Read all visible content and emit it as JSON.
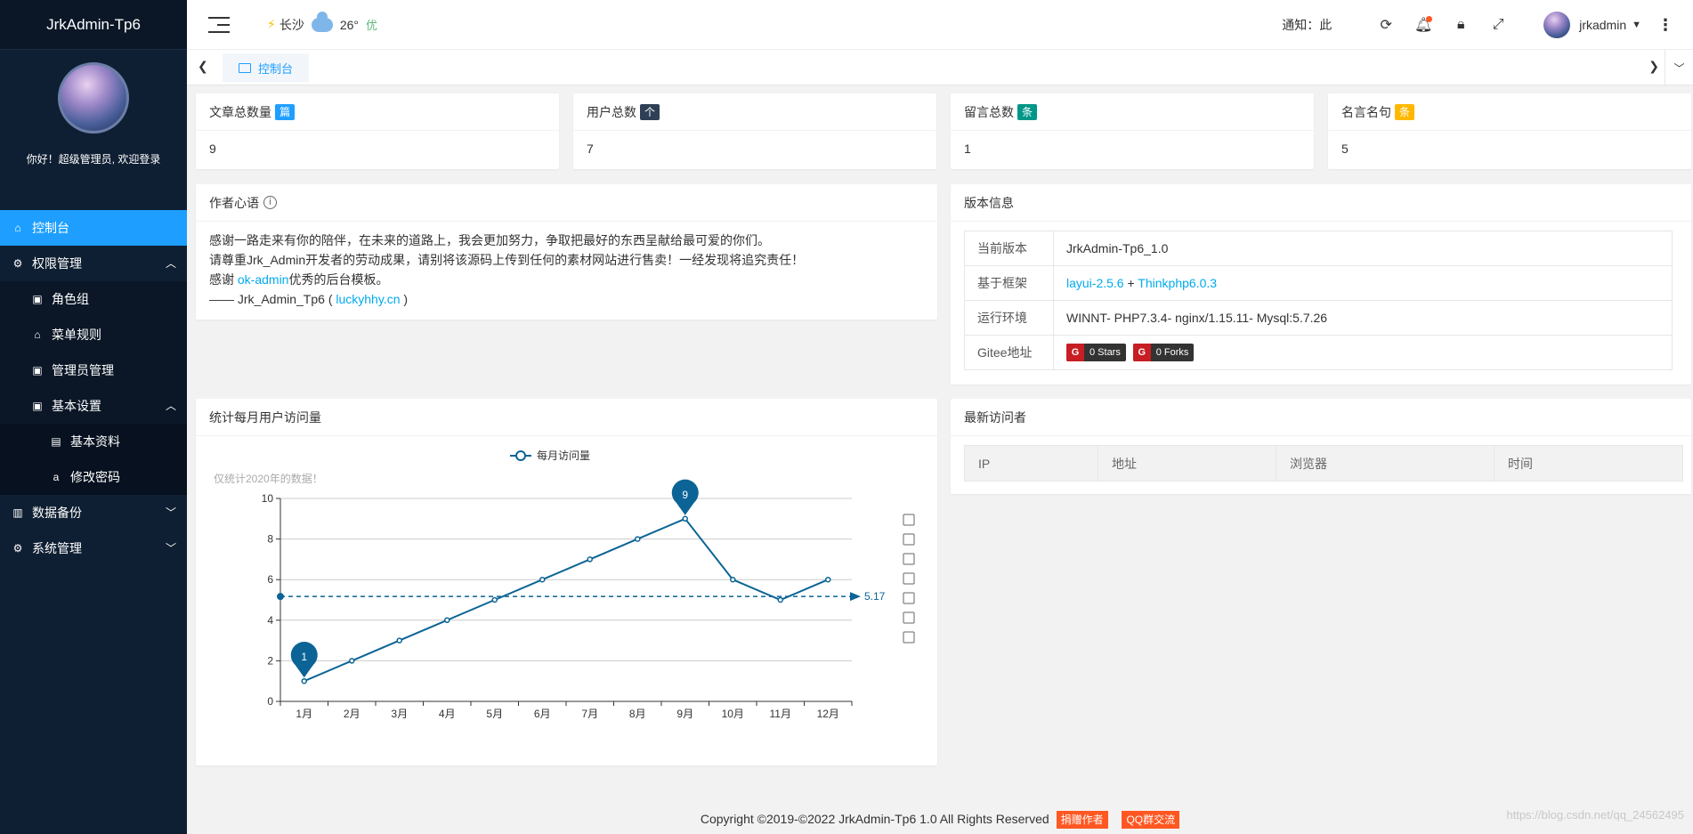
{
  "brand": "JrkAdmin-Tp6",
  "welcome": "你好！超级管理员, 欢迎登录",
  "menu": {
    "dashboard": "控制台",
    "auth": "权限管理",
    "role_group": "角色组",
    "menu_rules": "菜单规则",
    "admin_manage": "管理员管理",
    "basic_settings": "基本设置",
    "basic_profile": "基本资料",
    "change_password": "修改密码",
    "data_backup": "数据备份",
    "system_manage": "系统管理"
  },
  "header": {
    "city": "长沙",
    "temp": "26°",
    "air": "优",
    "notice": "通知：此",
    "username": "jrkadmin"
  },
  "tab": {
    "active": "控制台"
  },
  "stats": [
    {
      "label": "文章总数量",
      "badge": "篇",
      "value": "9",
      "color": "#1E9FFF"
    },
    {
      "label": "用户总数",
      "badge": "个",
      "value": "7",
      "color": "#2F4056"
    },
    {
      "label": "留言总数",
      "badge": "条",
      "value": "1",
      "color": "#009688"
    },
    {
      "label": "名言名句",
      "badge": "条",
      "value": "5",
      "color": "#FFB800"
    }
  ],
  "author": {
    "title": "作者心语",
    "line1": "感谢一路走来有你的陪伴，在未来的道路上，我会更加努力，争取把最好的东西呈献给最可爱的你们。",
    "line2": "请尊重Jrk_Admin开发者的劳动成果，请别将该源码上传到任何的素材网站进行售卖！一经发现将追究责任！",
    "line3_pre": "感谢 ",
    "line3_link": "ok-admin",
    "line3_post": "优秀的后台模板。",
    "line4_pre": "—— Jrk_Admin_Tp6 ( ",
    "line4_link": "luckyhhy.cn",
    "line4_post": " )"
  },
  "version": {
    "title": "版本信息",
    "rows": {
      "current_k": "当前版本",
      "current_v": "JrkAdmin-Tp6_1.0",
      "framework_k": "基于框架",
      "framework_v1": "layui-2.5.6",
      "framework_plus": " + ",
      "framework_v2": "Thinkphp6.0.3",
      "env_k": "运行环境",
      "env_v": "WINNT- PHP7.3.4- nginx/1.15.11- Mysql:5.7.26",
      "gitee_k": "Gitee地址",
      "gitee_g": "G",
      "stars": "0 Stars",
      "forks": "0 Forks"
    }
  },
  "chart_card": {
    "title": "统计每月用户访问量"
  },
  "visitors": {
    "title": "最新访问者",
    "columns": [
      "IP",
      "地址",
      "浏览器",
      "时间"
    ]
  },
  "chart_data": {
    "type": "line",
    "subtitle": "仅统计2020年的数据！",
    "categories": [
      "1月",
      "2月",
      "3月",
      "4月",
      "5月",
      "6月",
      "7月",
      "8月",
      "9月",
      "10月",
      "11月",
      "12月"
    ],
    "series": [
      {
        "name": "每月访问量",
        "values": [
          1,
          2,
          3,
          4,
          5,
          6,
          7,
          8,
          9,
          6,
          5,
          6
        ]
      }
    ],
    "ylim": [
      0,
      10
    ],
    "yticks": [
      0,
      2,
      4,
      6,
      8,
      10
    ],
    "mark_points": [
      {
        "label": "1",
        "index": 0
      },
      {
        "label": "9",
        "index": 8
      }
    ],
    "mark_line": {
      "label": "5.17",
      "value": 5.17
    },
    "line_color": "#0b6495",
    "legend": "top-center"
  },
  "footer": {
    "copyright": "Copyright ©2019-©2022 JrkAdmin-Tp6 1.0 All Rights Reserved",
    "donate": "捐赠作者",
    "qq": "QQ群交流"
  },
  "watermark": "https://blog.csdn.net/qq_24562495"
}
